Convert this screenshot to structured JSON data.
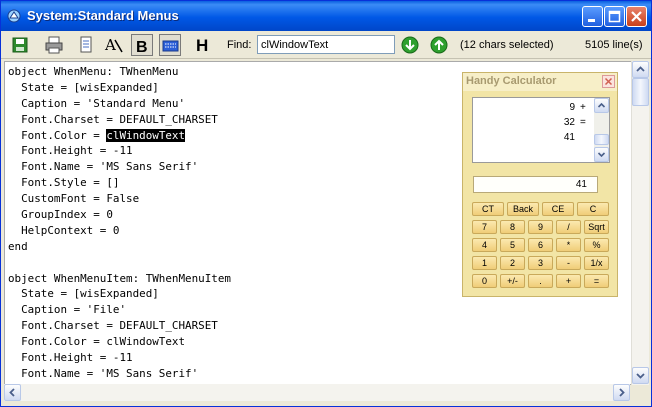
{
  "window": {
    "title": "System:Standard Menus"
  },
  "toolbar": {
    "find_label": "Find:",
    "find_value": "clWindowText",
    "selection_status": "(12 chars selected)",
    "line_count": "5105 line(s)"
  },
  "editor": {
    "lines": [
      {
        "text": "object WhenMenu: TWhenMenu"
      },
      {
        "text": "  State = [wisExpanded]"
      },
      {
        "text": "  Caption = 'Standard Menu'"
      },
      {
        "text": "  Font.Charset = DEFAULT_CHARSET"
      },
      {
        "before": "  Font.Color = ",
        "selected": "clWindowText",
        "after": ""
      },
      {
        "text": "  Font.Height = -11"
      },
      {
        "text": "  Font.Name = 'MS Sans Serif'"
      },
      {
        "text": "  Font.Style = []"
      },
      {
        "text": "  CustomFont = False"
      },
      {
        "text": "  GroupIndex = 0"
      },
      {
        "text": "  HelpContext = 0"
      },
      {
        "text": "end"
      },
      {
        "text": ""
      },
      {
        "text": "object WhenMenuItem: TWhenMenuItem"
      },
      {
        "text": "  State = [wisExpanded]"
      },
      {
        "text": "  Caption = 'File'"
      },
      {
        "text": "  Font.Charset = DEFAULT_CHARSET"
      },
      {
        "text": "  Font.Color = clWindowText"
      },
      {
        "text": "  Font.Height = -11"
      },
      {
        "text": "  Font.Name = 'MS Sans Serif'"
      }
    ]
  },
  "calculator": {
    "title": "Handy Calculator",
    "tape": [
      {
        "value": "9",
        "op": "+"
      },
      {
        "value": "32",
        "op": "="
      },
      {
        "value": "41",
        "op": ""
      }
    ],
    "display": "41",
    "keys": [
      [
        "CT",
        "Back",
        "CE",
        "C"
      ],
      [
        "7",
        "8",
        "9",
        "/",
        "Sqrt"
      ],
      [
        "4",
        "5",
        "6",
        "*",
        "%"
      ],
      [
        "1",
        "2",
        "3",
        "-",
        "1/x"
      ],
      [
        "0",
        "+/-",
        ".",
        "+",
        "="
      ]
    ]
  },
  "colors": {
    "title_bar": "#0058e6",
    "calculator_bg": "#f2e5a6",
    "selection": "#000000"
  }
}
